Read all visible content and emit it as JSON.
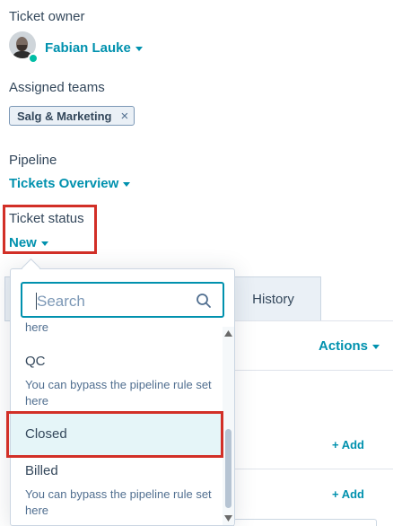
{
  "owner": {
    "label": "Ticket owner",
    "name": "Fabian Lauke"
  },
  "teams": {
    "label": "Assigned teams",
    "tag": "Salg & Marketing",
    "remove_glyph": "×"
  },
  "pipeline": {
    "label": "Pipeline",
    "value": "Tickets Overview"
  },
  "status": {
    "label": "Ticket status",
    "value": "New"
  },
  "tabs": {
    "history": "History"
  },
  "actions": {
    "label": "Actions"
  },
  "add_rows": [
    {
      "label": "+ Add"
    },
    {
      "label": "+ Add"
    }
  ],
  "dropdown": {
    "search_placeholder": "Search",
    "partial_text": "here",
    "options": [
      {
        "title": "QC",
        "subtitle": "You can bypass the pipeline rule set here"
      },
      {
        "title": "Closed"
      },
      {
        "title": "Billed",
        "subtitle": "You can bypass the pipeline rule set here"
      }
    ]
  },
  "colors": {
    "accent": "#0091ae",
    "highlight_border": "#d22f27",
    "highlight_bg": "#e5f5f8"
  }
}
